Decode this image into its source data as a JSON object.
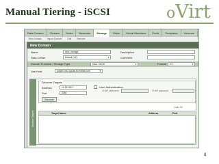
{
  "slide": {
    "title": "Manual Tiering - iSCSI",
    "logo": {
      "small": "o",
      "rest": "Virt"
    },
    "page_number": "8"
  },
  "tabs": [
    "Data Centers",
    "Clusters",
    "Hosts",
    "Networks",
    "Storage",
    "Disks",
    "Virtual Machines",
    "Pools",
    "Templates",
    "Volumes"
  ],
  "active_tab": "Storage",
  "subtabs": [
    "New Domain",
    "Import Domain",
    "Edit",
    "Remove"
  ],
  "dialog": {
    "title": "New Domain",
    "name_label": "Name",
    "name_value": "iscsi_storage",
    "description_label": "Description",
    "datacenter_label": "Data Center",
    "datacenter_value": "Default (V3)",
    "comment_label": "Comment",
    "function_label": "Domain Function / Storage Type",
    "function_value": "Data / iSCSI",
    "format_label": "Format",
    "format_value": "V3",
    "host_label": "Use Host",
    "host_value": "purple-vds1.qa.lab.tlv.redhat.com",
    "vtab_label": "Discover Targets",
    "discover": {
      "label": "Discover Targets",
      "address_label": "Address",
      "address_value": "10.35.160.7",
      "port_label": "Port",
      "port_value": "3260",
      "auth_label": "User Authentication:",
      "chap_user_label": "CHAP username",
      "chap_pass_label": "CHAP password",
      "button": "Discover"
    },
    "login_all": "Login All",
    "grid_headers": {
      "target": "Target Name",
      "address": "Address",
      "port": "Port"
    }
  }
}
